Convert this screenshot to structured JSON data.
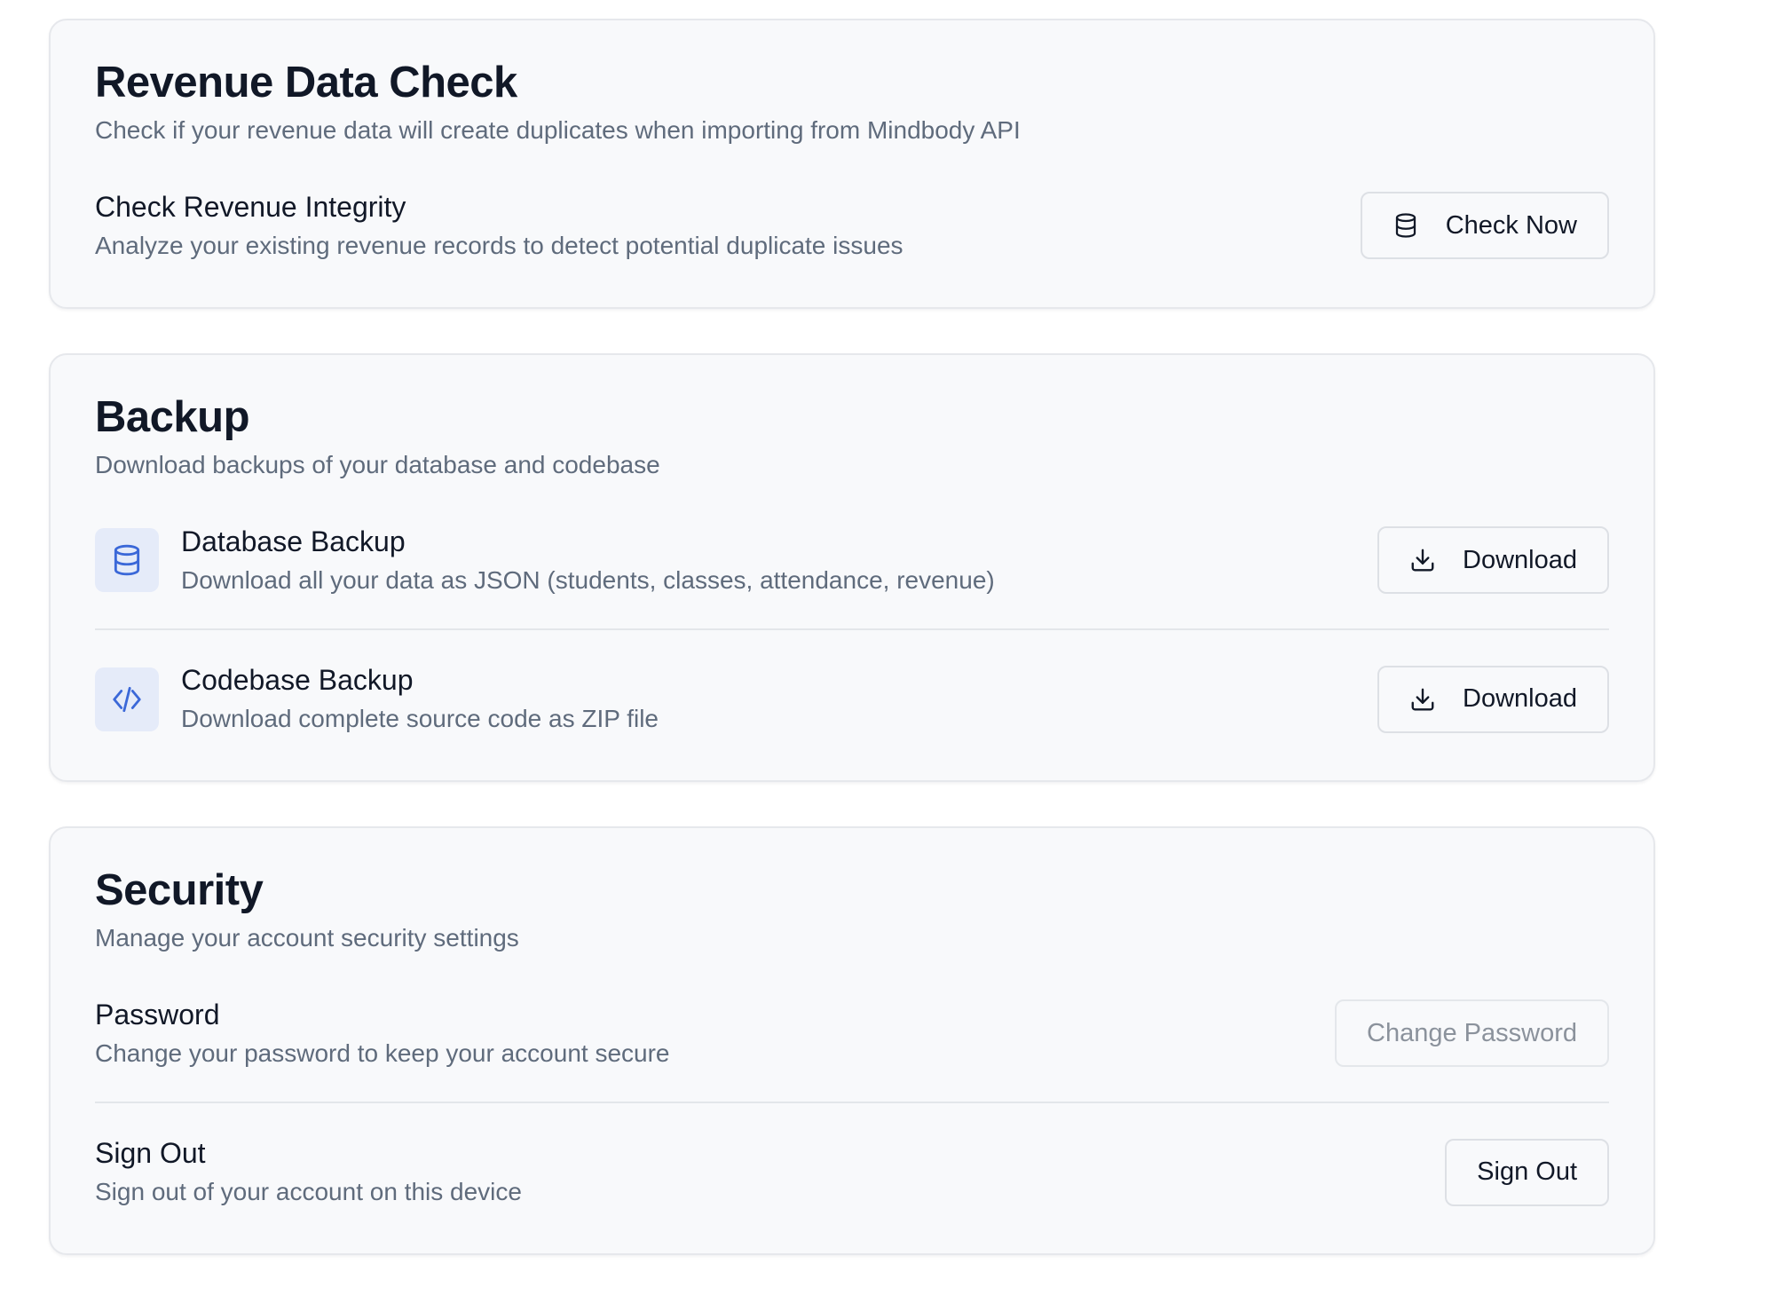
{
  "revenue_check": {
    "title": "Revenue Data Check",
    "description": "Check if your revenue data will create duplicates when importing from Mindbody API",
    "row": {
      "title": "Check Revenue Integrity",
      "description": "Analyze your existing revenue records to detect potential duplicate issues",
      "button_label": "Check Now",
      "button_icon": "database-icon"
    }
  },
  "backup": {
    "title": "Backup",
    "description": "Download backups of your database and codebase",
    "items": [
      {
        "title": "Database Backup",
        "description": "Download all your data as JSON (students, classes, attendance, revenue)",
        "icon": "database-icon",
        "button_label": "Download",
        "button_icon": "download-icon"
      },
      {
        "title": "Codebase Backup",
        "description": "Download complete source code as ZIP file",
        "icon": "code-icon",
        "button_label": "Download",
        "button_icon": "download-icon"
      }
    ]
  },
  "security": {
    "title": "Security",
    "description": "Manage your account security settings",
    "items": [
      {
        "title": "Password",
        "description": "Change your password to keep your account secure",
        "button_label": "Change Password",
        "button_state": "disabled"
      },
      {
        "title": "Sign Out",
        "description": "Sign out of your account on this device",
        "button_label": "Sign Out"
      }
    ]
  },
  "colors": {
    "accent": "#3b68d8",
    "icon_tile_bg": "#e5ebf9",
    "card_bg": "#f8f9fb",
    "muted_text": "#5f6b7c"
  }
}
